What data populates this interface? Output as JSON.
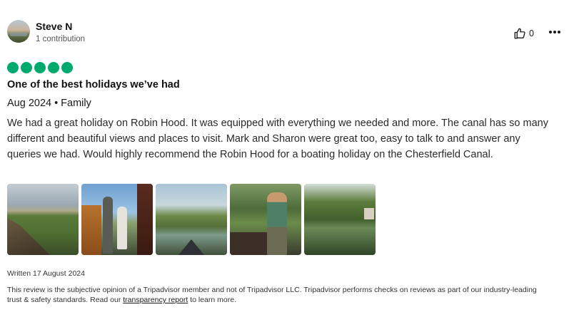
{
  "reviewer": {
    "name": "Steve N",
    "contributions": "1 contribution"
  },
  "actions": {
    "helpful_count": "0"
  },
  "rating": {
    "value": 5,
    "max": 5,
    "color": "#00aa6c"
  },
  "review": {
    "title": "One of the best holidays we’ve had",
    "date": "Aug 2024",
    "trip_type": "Family",
    "separator": "•",
    "text": "We had a great holiday on Robin Hood. It was equipped with everything we needed and more. The canal has so many different and beautiful views and places to visit. Mark and Sharon were great too, easy to talk to and answer any queries we had. Would highly recommend the Robin Hood for a boating holiday on the Chesterfield Canal."
  },
  "photos": [
    {
      "name": "canal-boat-bow-fields-photo"
    },
    {
      "name": "two-men-on-boat-deck-photo"
    },
    {
      "name": "canal-view-from-bow-photo"
    },
    {
      "name": "child-fishing-from-boat-photo"
    },
    {
      "name": "canal-with-trees-photo"
    }
  ],
  "footer": {
    "written": "Written 17 August 2024",
    "disclaimer_pre": "This review is the subjective opinion of a Tripadvisor member and not of Tripadvisor LLC. Tripadvisor performs checks on reviews as part of our industry-leading trust & safety standards. Read our ",
    "disclaimer_link": "transparency report",
    "disclaimer_post": " to learn more."
  }
}
